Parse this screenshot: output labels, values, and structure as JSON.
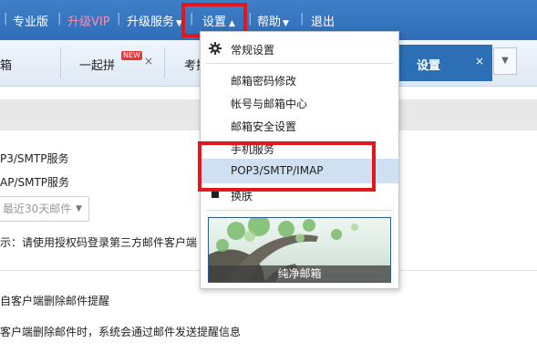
{
  "topnav": {
    "items": [
      "专业版",
      "升级VIP",
      "升级服务",
      "设置",
      "帮助",
      "退出"
    ]
  },
  "tabs": {
    "items": [
      {
        "label": "箱"
      },
      {
        "label": "一起拼",
        "badge": "NEW"
      },
      {
        "label": "考拉"
      }
    ],
    "active": {
      "label": "设置",
      "close": "×"
    },
    "close": "×"
  },
  "content": {
    "pop3": "P3/SMTP服务",
    "imap": "AP/SMTP服务",
    "select_value": "最近30天邮件",
    "hint": "示：请使用授权码登录第三方邮件客户端",
    "delete_notice": "自客户端删除邮件提醒",
    "delete_desc": "客户端删除邮件时，系统会通过邮件发送提醒信息"
  },
  "menu": {
    "general": "常规设置",
    "items": [
      "邮箱密码修改",
      "帐号与邮箱中心",
      "邮箱安全设置",
      "手机服务",
      "POP3/SMTP/IMAP",
      "换肤"
    ],
    "banner_caption": "纯净邮箱"
  },
  "colors": {
    "highlight": "#e3161c",
    "nav_bg": "#3476c0",
    "active_tab": "#2c6fb4",
    "selected_item": "#cfe0f3"
  }
}
